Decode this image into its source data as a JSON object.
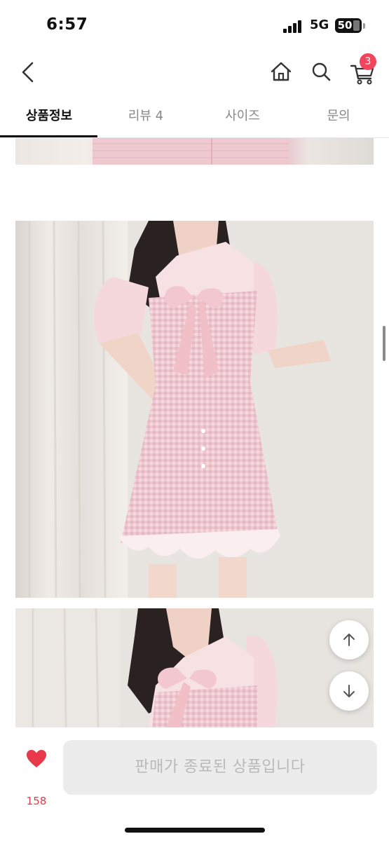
{
  "status_bar": {
    "time": "6:57",
    "network": "5G",
    "battery": "50"
  },
  "header": {
    "back_icon": "chevron-left-icon",
    "home_icon": "home-icon",
    "search_icon": "search-icon",
    "cart_icon": "cart-icon",
    "cart_count": "3"
  },
  "tabs": [
    {
      "label": "상품정보",
      "active": true
    },
    {
      "label": "리뷰 4",
      "active": false
    },
    {
      "label": "사이즈",
      "active": false
    },
    {
      "label": "문의",
      "active": false
    }
  ],
  "floating": {
    "up_icon": "arrow-up-icon",
    "down_icon": "arrow-down-icon"
  },
  "bottom_bar": {
    "like_icon": "heart-icon",
    "like_count": "158",
    "status_button": "판매가 종료된 상품입니다"
  },
  "colors": {
    "accent": "#e8394a",
    "badge": "#f0455a",
    "disabled_bg": "#ececec",
    "disabled_text": "#b9b9b9",
    "dress_pink": "#eec9cf"
  }
}
